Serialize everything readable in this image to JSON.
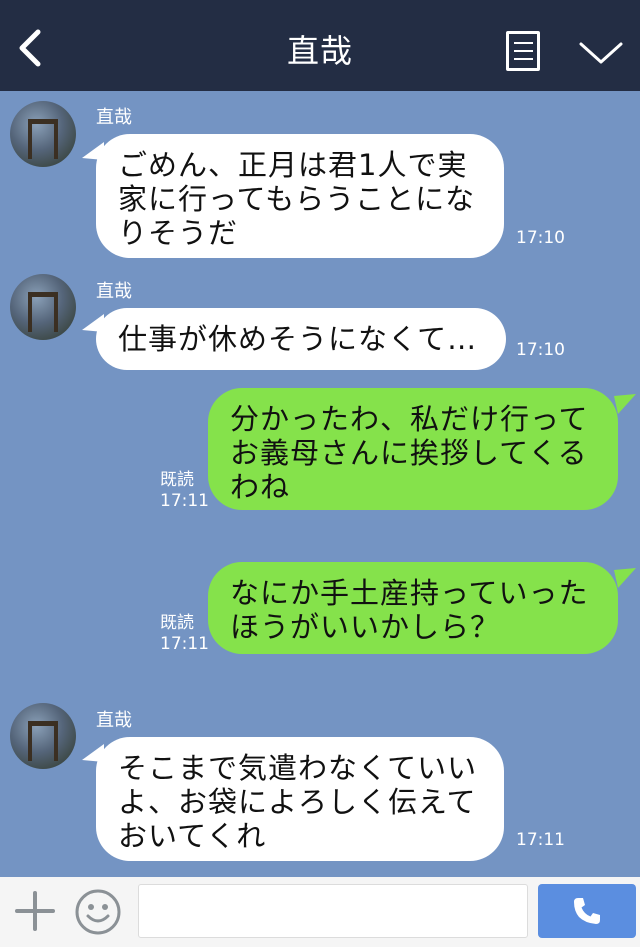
{
  "header": {
    "title": "直哉",
    "back_icon": "chevron-left-icon",
    "notes_icon": "notes-icon",
    "menu_icon": "chevron-down-icon"
  },
  "messages": [
    {
      "sender": "直哉",
      "text": "ごめん、正月は君1人で実\n家に行ってもらうことにな\nりそうだ",
      "time": "17:10"
    },
    {
      "sender": "直哉",
      "text": "仕事が休めそうになくて…",
      "time": "17:10"
    },
    {
      "text": "分かったわ、私だけ行って\nお義母さんに挨拶してくる\nわね",
      "read": "既読",
      "time": "17:11"
    },
    {
      "text": "なにか手土産持っていった\nほうがいいかしら？",
      "read": "既読",
      "time": "17:11"
    },
    {
      "sender": "直哉",
      "text": "そこまで気遣わなくていい\nよ、お袋によろしく伝えて\nおいてくれ",
      "time": "17:11"
    }
  ],
  "input_bar": {
    "placeholder": "",
    "plus_icon": "plus-icon",
    "emoji_icon": "smiley-icon",
    "call_icon": "phone-icon"
  },
  "colors": {
    "header_bg": "#232d44",
    "chat_bg": "#7494c3",
    "incoming_bubble": "#ffffff",
    "outgoing_bubble": "#85e24b",
    "call_button": "#5b8ee0"
  }
}
